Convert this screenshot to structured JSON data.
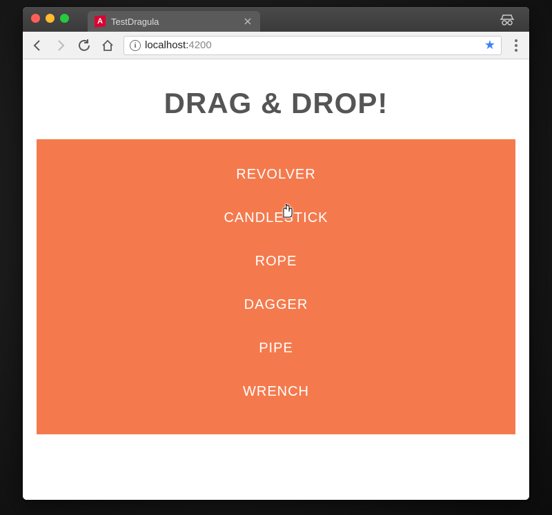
{
  "browser": {
    "tab_title": "TestDragula",
    "favicon_letter": "A",
    "url_host": "localhost:",
    "url_port": "4200"
  },
  "page": {
    "heading": "DRAG & DROP!",
    "items": [
      "REVOLVER",
      "CANDLESTICK",
      "ROPE",
      "DAGGER",
      "PIPE",
      "WRENCH"
    ]
  },
  "colors": {
    "panel_bg": "#f47a4d",
    "heading": "#555555"
  }
}
